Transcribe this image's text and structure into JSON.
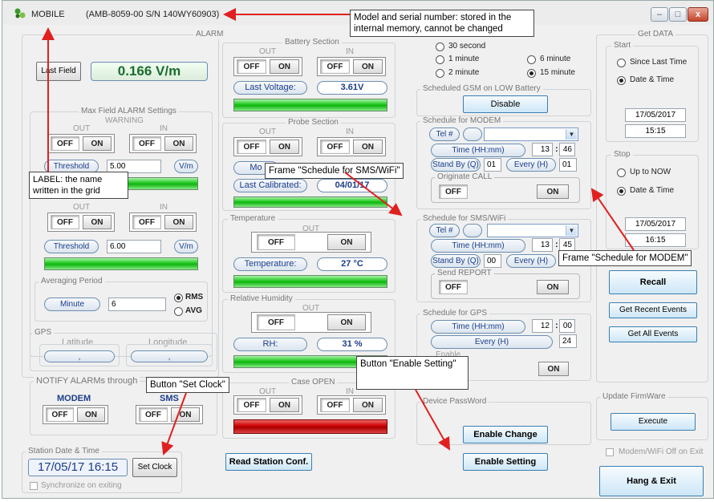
{
  "window": {
    "app_name": "MOBILE",
    "model_serial": "(AMB-8059-00   S/N 140WY60903)",
    "minimize": "–",
    "maximize": "□",
    "close": "x"
  },
  "alarm": {
    "legend": "ALARM",
    "last_field_button": "Last Field",
    "last_field_value": "0.166 V/m",
    "max_field_legend": "Max Field ALARM Settings",
    "warning_legend": "WARNING",
    "out": "OUT",
    "in": "IN",
    "off": "OFF",
    "on": "ON",
    "threshold1_label": "Threshold",
    "threshold1_value": "5.00",
    "threshold1_unit": "V/m",
    "threshold2_label": "Threshold",
    "threshold2_value": "6.00",
    "threshold2_unit": "V/m",
    "averaging_legend": "Averaging Period",
    "averaging_button": "Minute",
    "averaging_value": "6",
    "rms": "RMS",
    "avg": "AVG"
  },
  "gps": {
    "legend": "GPS",
    "latitude": "Latitude",
    "longitude": "Longitude",
    "lat_value": ",",
    "lon_value": ","
  },
  "notify": {
    "legend": "NOTIFY ALARMs through",
    "modem": "MODEM",
    "sms": "SMS",
    "off": "OFF",
    "on": "ON"
  },
  "station_time": {
    "legend": "Station Date & Time",
    "value": "17/05/17  16:15",
    "set_clock": "Set Clock",
    "sync": "Synchronize on exiting"
  },
  "battery": {
    "legend": "Battery Section",
    "out": "OUT",
    "in": "IN",
    "off": "OFF",
    "on": "ON",
    "last_voltage_label": "Last Voltage:",
    "last_voltage_value": "3.61V"
  },
  "probe": {
    "legend": "Probe Section",
    "out": "OUT",
    "in": "IN",
    "off": "OFF",
    "on": "ON",
    "model_label_partial": "Mo",
    "last_calibrated_label": "Last Calibrated:",
    "last_calibrated_value": "04/01/17"
  },
  "temperature": {
    "legend": "Temperature",
    "out": "OUT",
    "off": "OFF",
    "on": "ON",
    "label": "Temperature:",
    "value": "27 °C"
  },
  "humidity": {
    "legend": "Relative Humidity",
    "out": "OUT",
    "off": "OFF",
    "on": "ON",
    "label": "RH:",
    "value": "31 %"
  },
  "case_open": {
    "legend": "Case OPEN",
    "out": "OUT",
    "in": "IN",
    "off": "OFF",
    "on": "ON"
  },
  "read_conf": "Read Station Conf.",
  "interval": {
    "opt_30s": "30 second",
    "opt_1m": "1 minute",
    "opt_2m": "2 minute",
    "opt_6m": "6 minute",
    "opt_15m": "15 minute"
  },
  "gsm_low_battery": {
    "legend": "Scheduled GSM on LOW Battery",
    "button": "Disable"
  },
  "modem_schedule": {
    "legend": "Schedule for MODEM",
    "tel": "Tel #",
    "time_label": "Time (HH:mm)",
    "hh": "13",
    "mm": "46",
    "standby_label": "Stand By (Q)",
    "standby_value": "01",
    "every_label": "Every (H)",
    "every_value": "01",
    "originate_legend": "Originate CALL",
    "off": "OFF",
    "on": "ON"
  },
  "sms_schedule": {
    "legend": "Schedule for SMS/WiFi",
    "tel": "Tel #",
    "time_label": "Time (HH:mm)",
    "hh": "13",
    "mm": "45",
    "standby_label": "Stand By (Q)",
    "standby_value": "00",
    "every_label": "Every (H)",
    "send_legend": "Send REPORT",
    "off": "OFF",
    "on": "ON"
  },
  "gps_schedule": {
    "legend": "Schedule for GPS",
    "time_label": "Time (HH:mm)",
    "hh": "12",
    "mm": "00",
    "every_label": "Every (H)",
    "every_value": "24",
    "enable_legend": "Enable",
    "on": "ON"
  },
  "password": {
    "legend": "Device PassWord",
    "enable_change": "Enable Change",
    "enable_setting": "Enable Setting"
  },
  "get_data": {
    "legend": "Get DATA",
    "start_legend": "Start",
    "since_last": "Since Last Time",
    "date_time": "Date & Time",
    "start_date": "17/05/2017",
    "start_time": "15:15",
    "stop_legend": "Stop",
    "up_to_now": "Up to NOW",
    "stop_date_time": "Date & Time",
    "stop_date": "17/05/2017",
    "stop_time": "16:15",
    "recall": "Recall",
    "recent_events": "Get Recent Events",
    "all_events": "Get All Events"
  },
  "firmware": {
    "legend": "Update FirmWare",
    "execute": "Execute"
  },
  "modem_wifi_off": "Modem/WiFi  Off on Exit",
  "hang_exit": "Hang & Exit",
  "annotations": {
    "model_serial": "Model and serial number: stored in the internal memory, cannot be changed",
    "label_name": "LABEL: the name written in the grid",
    "frame_sms": "Frame \"Schedule for SMS/WiFi\"",
    "frame_modem": "Frame \"Schedule for MODEM\"",
    "button_enable": "Button \"Enable Setting\"",
    "button_clock": "Button \"Set Clock\""
  }
}
